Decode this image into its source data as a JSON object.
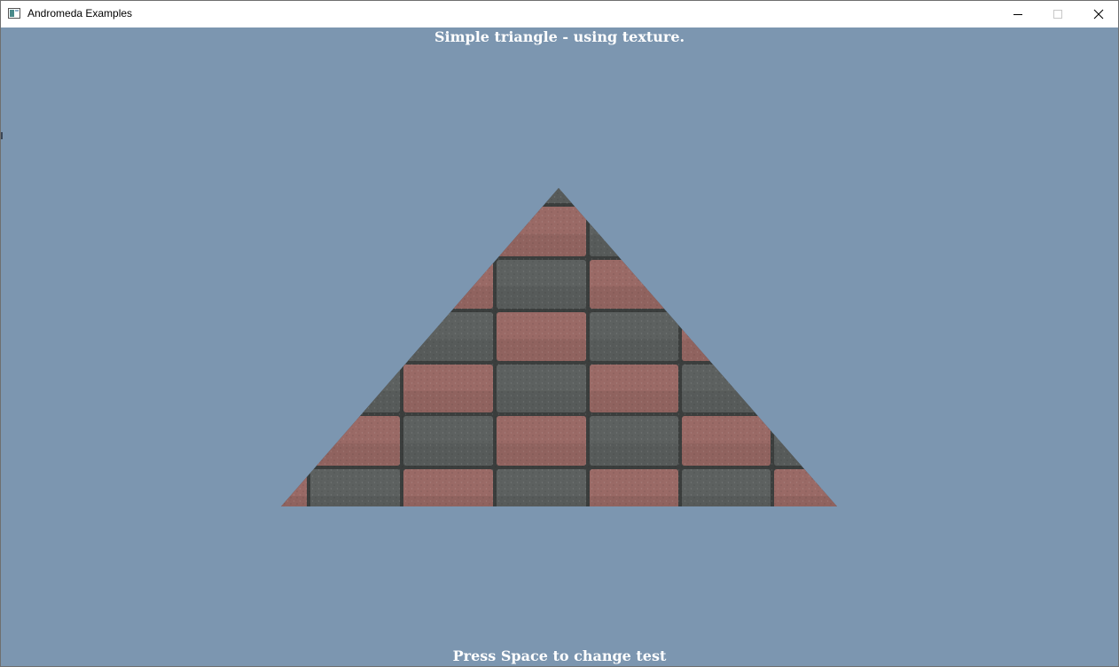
{
  "window": {
    "title": "Andromeda Examples",
    "icon": "app-window-icon",
    "controls": {
      "minimize": "minimize-icon",
      "maximize": "maximize-icon",
      "close": "close-icon"
    }
  },
  "scene": {
    "background_color": "#7c96b0",
    "header_text": "Simple triangle - using texture.",
    "footer_text": "Press Space to change test",
    "shape": "triangle",
    "texture": "checkered brick pavers (alternating red-brown and dark grey)",
    "texture_colors": {
      "red_brick": "#9a6a66",
      "grey_brick": "#5d6160",
      "mortar": "#3b3e3d"
    }
  }
}
